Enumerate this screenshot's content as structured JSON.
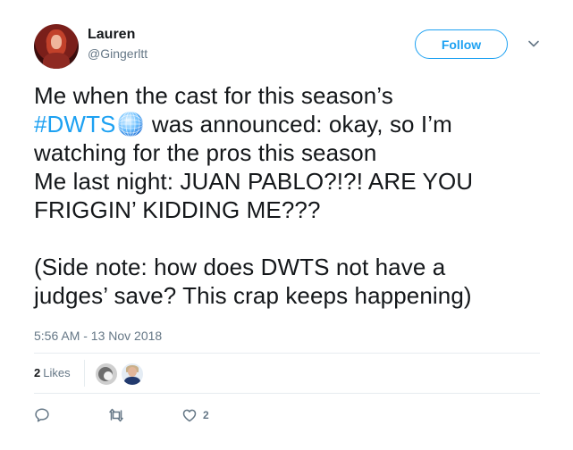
{
  "author": {
    "name": "Lauren",
    "handle": "@Gingerltt"
  },
  "follow_button": {
    "label": "Follow"
  },
  "tweet": {
    "line1": "Me when the cast for this season’s",
    "hashtag": "#DWTS",
    "line2_rest": " was announced: okay, so I’m",
    "line3": "watching for the pros this season",
    "line4": "Me last night: JUAN PABLO?!?! ARE YOU",
    "line5": "FRIGGIN’ KIDDING ME???",
    "line6": "(Side note: how does DWTS not have a",
    "line7": "judges’ save? This crap keeps happening)"
  },
  "timestamp": "5:56 AM - 13 Nov 2018",
  "likes": {
    "count": "2",
    "label": "Likes"
  },
  "actions": {
    "like_count": "2"
  },
  "colors": {
    "accent": "#1da1f2",
    "secondary_text": "#657786",
    "divider": "#e6ecf0"
  },
  "icons": [
    "chevron-down-icon",
    "disco-ball-emoji",
    "reply-icon",
    "retweet-icon",
    "heart-icon"
  ]
}
